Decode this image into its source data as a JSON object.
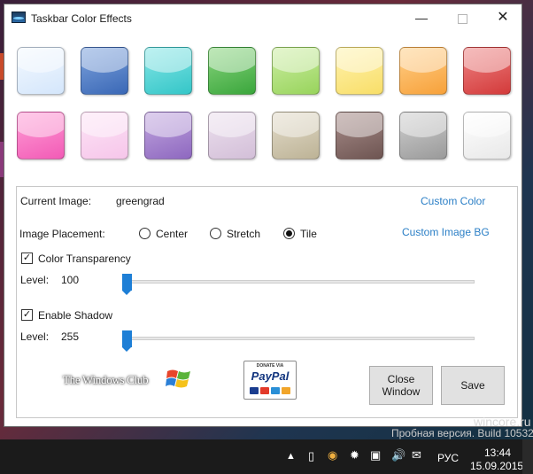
{
  "window": {
    "title": "Taskbar Color Effects"
  },
  "tiles": [
    {
      "name": "tile-white-blue",
      "top": "#f4f9ff",
      "bottom": "#d4e6fb"
    },
    {
      "name": "tile-blue",
      "top": "#7ea3dd",
      "bottom": "#3a68b6"
    },
    {
      "name": "tile-cyan",
      "top": "#86e6e6",
      "bottom": "#34c6c8"
    },
    {
      "name": "tile-green",
      "top": "#8ad57e",
      "bottom": "#3aa63c"
    },
    {
      "name": "tile-lime",
      "top": "#cdeea4",
      "bottom": "#98d45c"
    },
    {
      "name": "tile-yellow",
      "top": "#fff3b0",
      "bottom": "#f8de68"
    },
    {
      "name": "tile-orange",
      "top": "#ffd08a",
      "bottom": "#f7a13a"
    },
    {
      "name": "tile-red",
      "top": "#ee8585",
      "bottom": "#d33a3a"
    },
    {
      "name": "tile-pink",
      "top": "#ff9ed6",
      "bottom": "#f25bb6"
    },
    {
      "name": "tile-light-pink",
      "top": "#fde4f6",
      "bottom": "#f6c6ea"
    },
    {
      "name": "tile-purple",
      "top": "#c1a6de",
      "bottom": "#8e68c0"
    },
    {
      "name": "tile-lavender",
      "top": "#ece0ee",
      "bottom": "#d3bfd8"
    },
    {
      "name": "tile-beige",
      "top": "#e3dccb",
      "bottom": "#bdb396"
    },
    {
      "name": "tile-brown",
      "top": "#a88d8a",
      "bottom": "#6e5552"
    },
    {
      "name": "tile-gray",
      "top": "#cfcfcf",
      "bottom": "#9a9a9a"
    },
    {
      "name": "tile-white",
      "top": "#ffffff",
      "bottom": "#e8e8e8"
    }
  ],
  "settings": {
    "current_image_label": "Current Image:",
    "current_image_value": "greengrad",
    "custom_color_link": "Custom Color",
    "placement_label": "Image Placement:",
    "placement_options": [
      "Center",
      "Stretch",
      "Tile"
    ],
    "placement_selected": "Tile",
    "custom_bg_link": "Custom Image BG",
    "transparency_label": "Color Transparency",
    "transparency_checked": true,
    "transparency_level_label": "Level:",
    "transparency_level_value": "100",
    "shadow_label": "Enable Shadow",
    "shadow_checked": true,
    "shadow_level_label": "Level:",
    "shadow_level_value": "255"
  },
  "branding": {
    "twc_logo_text": "The Windows Club",
    "paypal_top": "DONATE VIA",
    "paypal_name": "PayPal"
  },
  "buttons": {
    "close_line1": "Close",
    "close_line2": "Window",
    "save": "Save"
  },
  "watermark": {
    "build": "Пробная версия. Build 10532",
    "site": "wincore.ru"
  },
  "taskbar": {
    "language": "РУС",
    "time": "13:44",
    "date": "15.09.2015"
  },
  "colors": {
    "accent_link": "#2b7fc6",
    "slider_thumb": "#1e7fd6",
    "taskbar": "#1b1b1b"
  }
}
